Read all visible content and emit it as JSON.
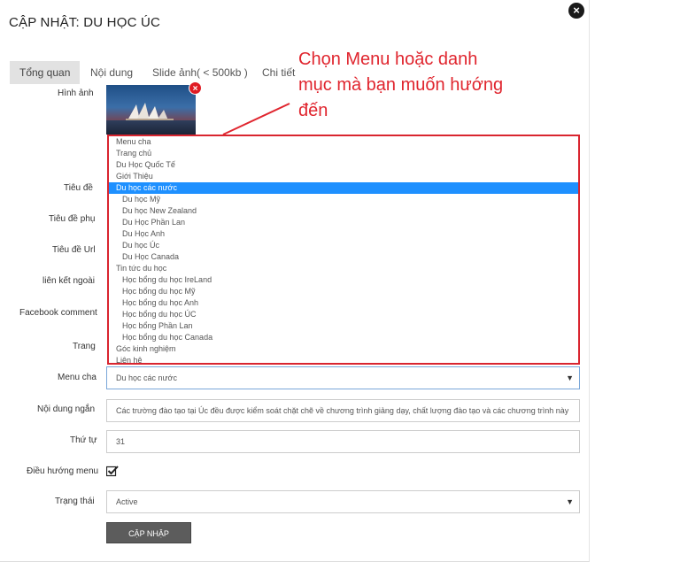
{
  "modal": {
    "title": "CẬP NHẬT: DU HỌC ÚC"
  },
  "tabs": [
    {
      "label": "Tổng quan"
    },
    {
      "label": "Nội dung"
    },
    {
      "label": "Slide ảnh( < 500kb )"
    },
    {
      "label": "Chi tiết"
    }
  ],
  "labels": {
    "image": "Hình ảnh",
    "title": "Tiêu đề",
    "subtitle": "Tiêu đề phụ",
    "url_title": "Tiêu đề Url",
    "external_link": "liên kết ngoài",
    "facebook_comment": "Facebook comment",
    "page": "Trang",
    "parent_menu": "Menu cha",
    "short_content": "Nội dung ngắn",
    "order": "Thứ tự",
    "menu_navigation": "Điều hướng menu",
    "status": "Trạng thái"
  },
  "callout": {
    "text": "Chọn Menu hoặc danh mục mà bạn muốn hướng đến"
  },
  "dropdown_options": [
    {
      "label": "Menu cha",
      "level": 1
    },
    {
      "label": "Trang chủ",
      "level": 1
    },
    {
      "label": "Du Học Quốc Tế",
      "level": 1
    },
    {
      "label": "Giới Thiệu",
      "level": 1
    },
    {
      "label": "Du học các nước",
      "level": 1,
      "selected": true
    },
    {
      "label": "Du học Mỹ",
      "level": 2
    },
    {
      "label": "Du học New Zealand",
      "level": 2
    },
    {
      "label": "Du Học Phần Lan",
      "level": 2
    },
    {
      "label": "Du Học Anh",
      "level": 2
    },
    {
      "label": "Du học Úc",
      "level": 2
    },
    {
      "label": "Du Học Canada",
      "level": 2
    },
    {
      "label": "Tin tức du học",
      "level": 1
    },
    {
      "label": "Học bổng du học IreLand",
      "level": 2
    },
    {
      "label": "Học bổng du học Mỹ",
      "level": 2
    },
    {
      "label": "Học bổng du học Anh",
      "level": 2
    },
    {
      "label": "Học bổng du học ÚC",
      "level": 2
    },
    {
      "label": "Học bổng Phần Lan",
      "level": 2
    },
    {
      "label": "Học bổng du học Canada",
      "level": 2
    },
    {
      "label": "Góc kinh nghiệm",
      "level": 1
    },
    {
      "label": "Liên hệ",
      "level": 1
    }
  ],
  "fields": {
    "parent_menu_value": "Du học các nước",
    "short_content_value": "Các trường đào tạo tại Úc đều được kiểm soát chặt chẽ về chương trình giảng dạy, chất lượng đào tạo và các chương trình này",
    "order_value": "31",
    "menu_navigation_checked": true,
    "status_value": "Active"
  },
  "buttons": {
    "submit": "CẬP NHẬP"
  },
  "icons": {
    "close": "close-icon",
    "remove_image": "remove-image-icon",
    "caret": "chevron-down-icon",
    "check": "check-icon"
  },
  "colors": {
    "accent_red": "#e0252e",
    "selected_blue": "#1e90ff",
    "button_gray": "#5c5c5c"
  }
}
